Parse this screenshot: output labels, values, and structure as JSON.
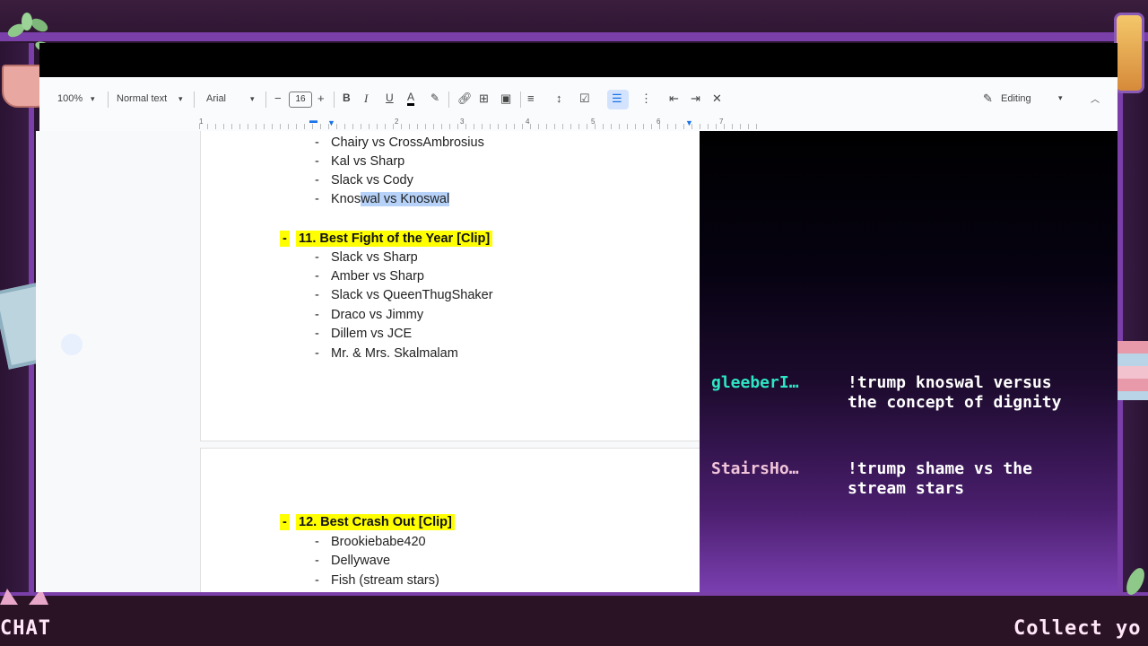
{
  "toolbar": {
    "zoom": "100%",
    "style": "Normal text",
    "font": "Arial",
    "font_size": "16",
    "mode": "Editing"
  },
  "ruler": {
    "numbers": [
      "1",
      "2",
      "3",
      "4",
      "5",
      "6",
      "7"
    ]
  },
  "document": {
    "list_a": [
      "Chairy vs CrossAmbrosius",
      "Kal vs Sharp",
      "Slack vs Cody"
    ],
    "last_a_plain": "Kno",
    "last_a_cursor": "s",
    "last_a_selected": "wal vs Knoswal",
    "heading_11": "11. Best Fight of the Year [Clip]",
    "list_11": [
      "Slack vs Sharp",
      "Amber vs Sharp",
      "Slack vs QueenThugShaker",
      "Draco vs Jimmy",
      "Dillem vs JCE",
      "Mr. & Mrs. Skalmalam"
    ],
    "heading_12": "12. Best Crash Out [Clip]",
    "list_12": [
      "Brookiebabe420",
      "Dellywave",
      "Fish (stream stars)"
    ],
    "dash": "-"
  },
  "chat": {
    "messages": [
      {
        "user": "gleeberI…",
        "text": "!trump knoswal versus the concept of dignity",
        "color": "#2ee6c4"
      },
      {
        "user": "StairsHo…",
        "text": "!trump shame vs the stream stars",
        "color": "#f2c4da"
      }
    ]
  },
  "overlay": {
    "ticker_left": "CHAT",
    "ticker_right": "Collect yo"
  }
}
